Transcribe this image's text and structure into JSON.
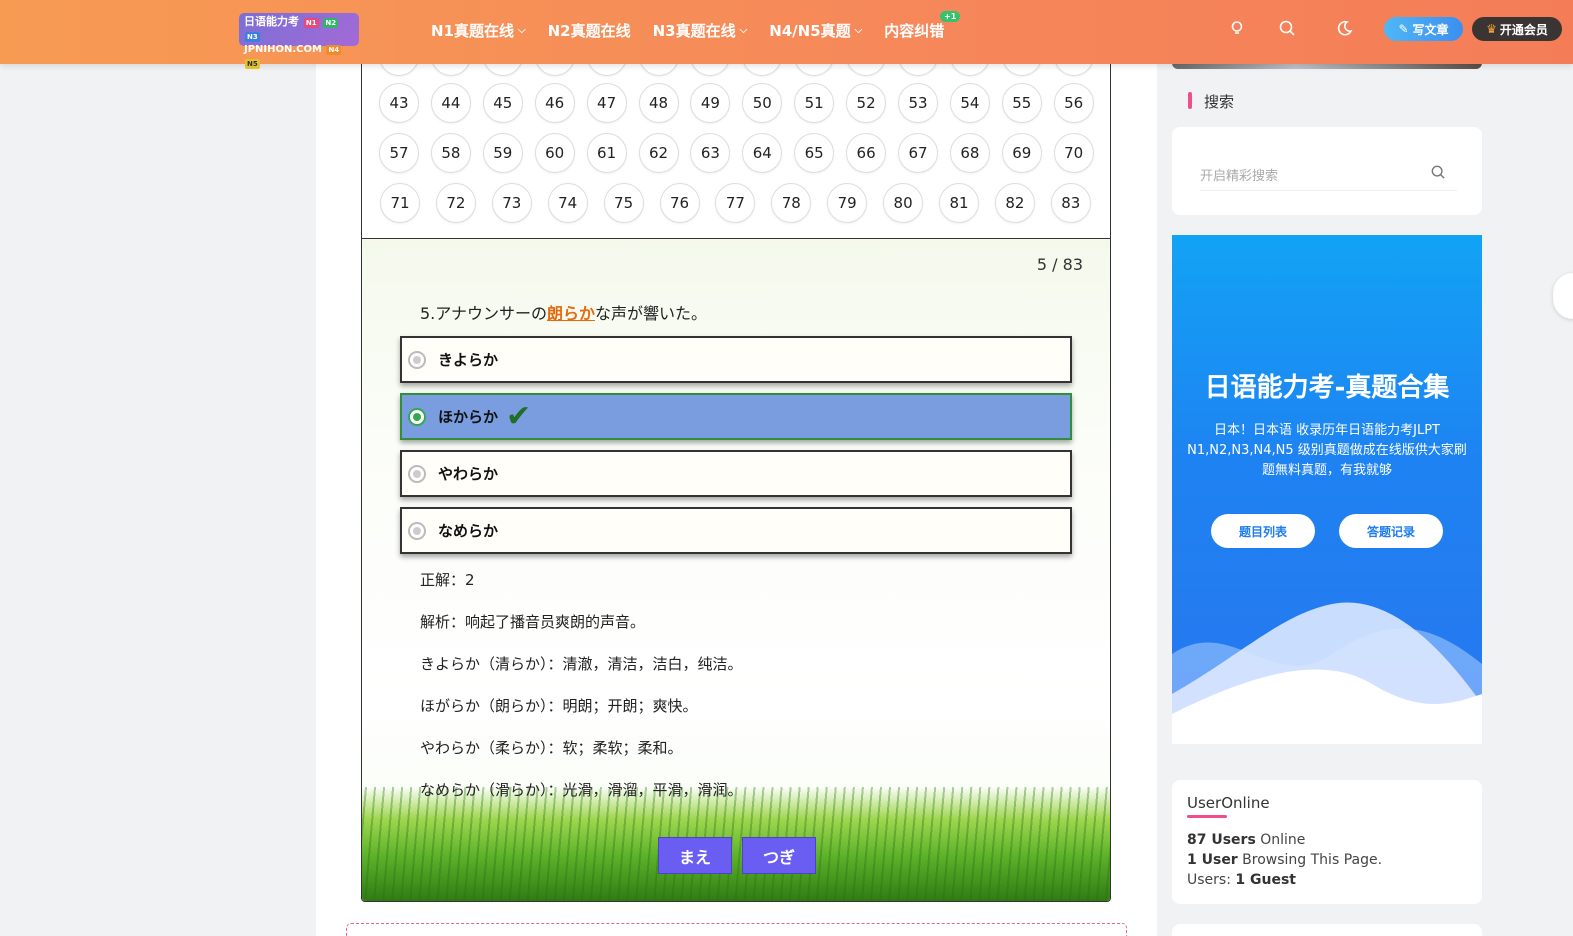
{
  "header": {
    "logo": {
      "line1": "日语能力考",
      "line2": "JPNIHON.COM",
      "tags": [
        "N1",
        "N2",
        "N3",
        "N4",
        "N5"
      ]
    },
    "nav": [
      {
        "label": "N1真题在线",
        "has_dropdown": true
      },
      {
        "label": "N2真题在线",
        "has_dropdown": false
      },
      {
        "label": "N3真题在线",
        "has_dropdown": true
      },
      {
        "label": "N4/N5真题",
        "has_dropdown": true
      },
      {
        "label": "内容纠错",
        "has_dropdown": false,
        "badge": "+1"
      }
    ],
    "write_label": "写文章",
    "vip_label": "开通会员"
  },
  "quiz": {
    "number_rows": [
      [
        "43",
        "44",
        "45",
        "46",
        "47",
        "48",
        "49",
        "50",
        "51",
        "52",
        "53",
        "54",
        "55",
        "56"
      ],
      [
        "57",
        "58",
        "59",
        "60",
        "61",
        "62",
        "63",
        "64",
        "65",
        "66",
        "67",
        "68",
        "69",
        "70"
      ],
      [
        "71",
        "72",
        "73",
        "74",
        "75",
        "76",
        "77",
        "78",
        "79",
        "80",
        "81",
        "82",
        "83"
      ]
    ],
    "progress": "5 / 83",
    "question_prefix": "5.アナウンサーの",
    "question_highlight": "朗らか",
    "question_suffix": "な声が響いた。",
    "options": [
      {
        "label": "きよらか",
        "selected": false
      },
      {
        "label": "ほからか",
        "selected": true
      },
      {
        "label": "やわらか",
        "selected": false
      },
      {
        "label": "なめらか",
        "selected": false
      }
    ],
    "answer": "正解：2",
    "explanations": [
      "解析：响起了播音员爽朗的声音。",
      "きよらか（清らか）：清澈，清洁，洁白，纯洁。",
      "ほがらか（朗らか）：明朗；开朗；爽快。",
      "やわらか（柔らか）：软；柔软；柔和。",
      "なめらか（滑らか）：光滑，滑溜，平滑，滑润。"
    ],
    "prev_label": "まえ",
    "next_label": "つぎ"
  },
  "sidebar": {
    "search_title": "搜索",
    "search_placeholder": "开启精彩搜索",
    "promo": {
      "title": "日语能力考-真题合集",
      "desc": "日本！日本语 收录历年日语能力考JLPT N1,N2,N3,N4,N5 级别真题做成在线版供大家刷题無料真题，有我就够",
      "btn1": "题目列表",
      "btn2": "答题记录"
    },
    "online": {
      "title": "UserOnline",
      "line1_bold": "87 Users",
      "line1_rest": " Online",
      "line2_bold": "1 User",
      "line2_rest": " Browsing This Page.",
      "line3_rest": "Users: ",
      "line3_bold": "1 Guest"
    }
  },
  "colors": {
    "header": "#f6875a",
    "accent_pink": "#f04e8c",
    "nav_button": "#6a5ef2",
    "selected_option": "#7a9de0",
    "promo_blue": "#1e82f2"
  }
}
